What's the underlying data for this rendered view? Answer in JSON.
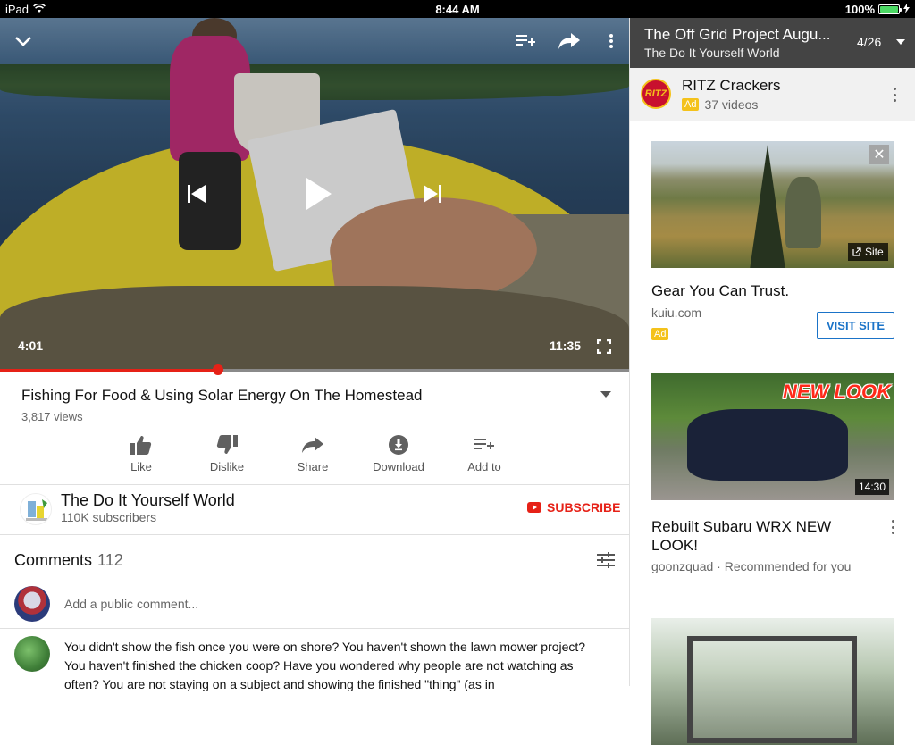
{
  "status_bar": {
    "device": "iPad",
    "time": "8:44 AM",
    "battery": "100%",
    "battery_level": 1.0
  },
  "player": {
    "current_time": "4:01",
    "duration": "11:35",
    "progress_fraction": 0.346
  },
  "video": {
    "title": "Fishing For Food & Using Solar Energy On The Homestead",
    "views": "3,817 views",
    "actions": [
      {
        "label": "Like",
        "icon": "thumbs-up-icon"
      },
      {
        "label": "Dislike",
        "icon": "thumbs-down-icon"
      },
      {
        "label": "Share",
        "icon": "share-icon"
      },
      {
        "label": "Download",
        "icon": "download-icon"
      },
      {
        "label": "Add to",
        "icon": "playlist-add-icon"
      }
    ]
  },
  "channel": {
    "name": "The Do It Yourself World",
    "subscribers": "110K subscribers",
    "subscribe_label": "SUBSCRIBE"
  },
  "comments": {
    "heading": "Comments",
    "count": "112",
    "add_placeholder": "Add a public comment...",
    "first_comment": "You didn't show the fish once you were on shore? You haven't shown the lawn mower project? You haven't finished the chicken coop? Have you wondered why people are not watching as often? You are not staying on a subject and showing the finished \"thing\" (as in"
  },
  "playlist": {
    "title": "The Off Grid Project Augu...",
    "channel": "The Do It Yourself World",
    "position": "4/26"
  },
  "ad": {
    "advertiser": "RITZ Crackers",
    "logo_text": "RITZ",
    "badge": "Ad",
    "videos": "37 videos",
    "site_chip": "Site",
    "card_title": "Gear You Can Trust.",
    "domain": "kuiu.com",
    "visit_label": "VISIT SITE",
    "close_glyph": "✕"
  },
  "recommended": [
    {
      "title": "Rebuilt Subaru WRX NEW LOOK!",
      "overlay_text": "NEW LOOK",
      "duration": "14:30",
      "channel": "goonzquad",
      "reason": "Recommended for you"
    }
  ],
  "colors": {
    "accent_red": "#e62117",
    "link_blue": "#1a73c8",
    "ad_yellow": "#f4c21b",
    "playlist_header": "#444444"
  }
}
